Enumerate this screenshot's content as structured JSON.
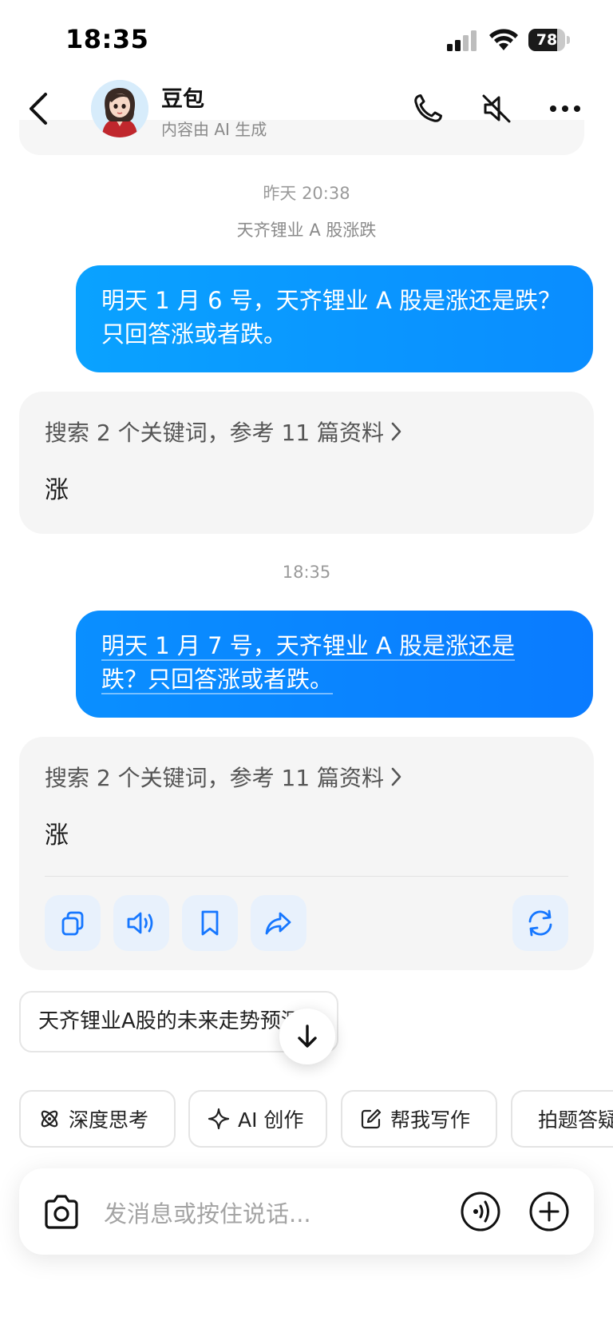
{
  "status_bar": {
    "time": "18:35",
    "battery": "78",
    "battery_level": 0.78
  },
  "header": {
    "name": "豆包",
    "subtitle": "内容由 AI 生成"
  },
  "conversation": {
    "session1": {
      "time": "昨天 20:38",
      "topic": "天齐锂业 A 股涨跌",
      "user_message": "明天 1 月 6 号，天齐锂业 A 股是涨还是跌？只回答涨或者跌。",
      "search_summary": "搜索 2 个关键词，参考 11 篇资料",
      "answer": "涨"
    },
    "session2": {
      "time": "18:35",
      "user_message_line1": "明天 1 月 7 号，天齐锂业 A 股是涨还是",
      "user_message_line2": "跌？只回答涨或者跌。",
      "search_summary": "搜索 2 个关键词，参考 11 篇资料",
      "answer": "涨"
    }
  },
  "suggestion": "天齐锂业A股的未来走势预测",
  "chips": [
    {
      "label": "深度思考",
      "icon": "atom-icon"
    },
    {
      "label": "AI 创作",
      "icon": "sparkle-icon"
    },
    {
      "label": "帮我写作",
      "icon": "edit-icon"
    },
    {
      "label": "拍题答疑",
      "icon": "photo-question-icon"
    }
  ],
  "input": {
    "placeholder": "发消息或按住说话..."
  },
  "colors": {
    "user_bubble": "#0a96ff",
    "accent": "#1677ff",
    "card_bg": "#f5f5f5"
  }
}
